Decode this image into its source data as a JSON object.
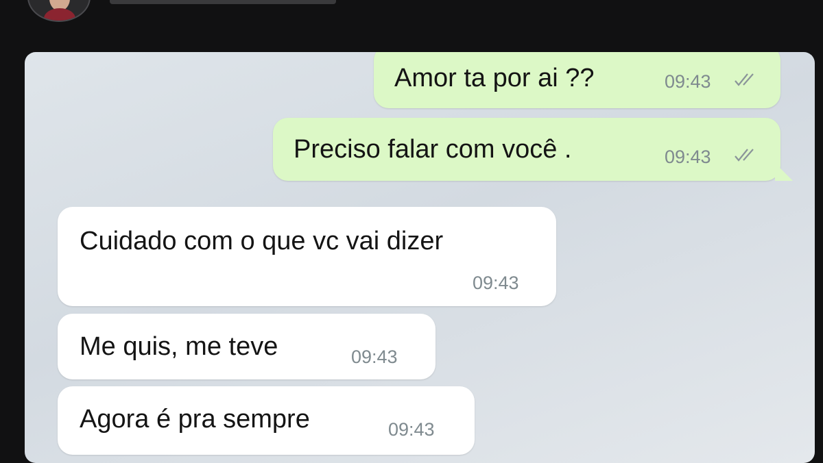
{
  "messages": [
    {
      "direction": "outgoing",
      "text": "Amor ta por ai ??",
      "time": "09:43",
      "status_icon": "double-check-icon"
    },
    {
      "direction": "outgoing",
      "text": "Preciso falar com você .",
      "time": "09:43",
      "status_icon": "double-check-icon"
    },
    {
      "direction": "incoming",
      "text": "Cuidado com o que vc vai dizer",
      "time": "09:43"
    },
    {
      "direction": "incoming",
      "text": "Me quis, me teve",
      "time": "09:43"
    },
    {
      "direction": "incoming",
      "text": "Agora é pra sempre",
      "time": "09:43"
    }
  ],
  "colors": {
    "outgoing_bubble": "#dcf8c6",
    "incoming_bubble": "#ffffff",
    "chat_background": "#d3dae1",
    "frame_background": "#111112",
    "timestamp": "#7f8a8f"
  }
}
